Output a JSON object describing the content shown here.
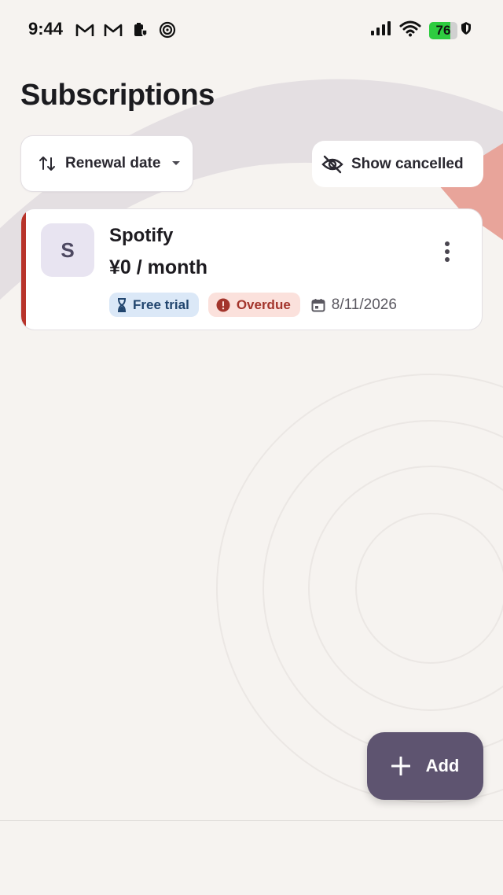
{
  "status_bar": {
    "time": "9:44",
    "battery_level": "76",
    "icons": [
      "gmail-icon",
      "gmail-icon",
      "clipboard-shield-icon",
      "spiral-icon",
      "signal-icon",
      "wifi-icon",
      "battery-icon",
      "shield-icon"
    ]
  },
  "header": {
    "title": "Subscriptions"
  },
  "toolbar": {
    "sort_label": "Renewal date",
    "sort_icon": "swap-vertical-icon",
    "show_cancelled_label": "Show cancelled",
    "show_cancelled_icon": "eye-off-icon"
  },
  "subscriptions": [
    {
      "initial": "S",
      "name": "Spotify",
      "price": "¥0 / month",
      "accent_color": "#b8332a",
      "badges": [
        {
          "label": "Free trial",
          "icon": "hourglass-icon",
          "bg": "#dbe8f7",
          "fg": "#21456e"
        },
        {
          "label": "Overdue",
          "icon": "alert-circle-icon",
          "bg": "#fbe1dc",
          "fg": "#a3352c"
        }
      ],
      "date": "8/11/2026",
      "date_icon": "calendar-icon"
    }
  ],
  "fab": {
    "label": "Add",
    "icon": "plus-icon"
  },
  "colors": {
    "background": "#f6f3f0",
    "fab": "#5e5470",
    "card": "#ffffff",
    "decor_gray": "#e2dde1",
    "decor_salmon": "#e8a49a"
  }
}
